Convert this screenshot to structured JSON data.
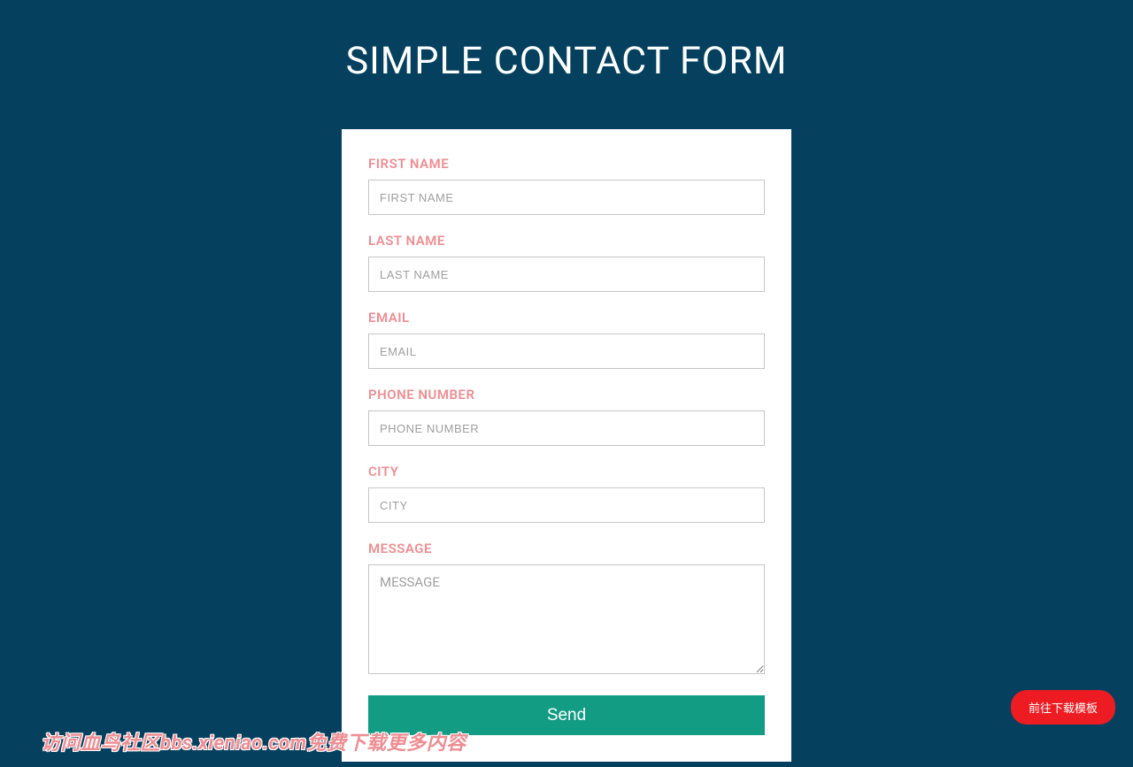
{
  "page": {
    "title": "SIMPLE CONTACT FORM"
  },
  "form": {
    "fields": {
      "first_name": {
        "label": "FIRST NAME",
        "placeholder": "FIRST NAME",
        "value": ""
      },
      "last_name": {
        "label": "LAST NAME",
        "placeholder": "LAST NAME",
        "value": ""
      },
      "email": {
        "label": "EMAIL",
        "placeholder": "EMAIL",
        "value": ""
      },
      "phone": {
        "label": "PHONE NUMBER",
        "placeholder": "PHONE NUMBER",
        "value": ""
      },
      "city": {
        "label": "CITY",
        "placeholder": "CITY",
        "value": ""
      },
      "message": {
        "label": "MESSAGE",
        "placeholder": "MESSAGE",
        "value": ""
      }
    },
    "submit_label": "Send"
  },
  "download_button": {
    "label": "前往下载模板"
  },
  "watermark": {
    "text": "访问血鸟社区bbs.xieniao.com免费下载更多内容"
  }
}
